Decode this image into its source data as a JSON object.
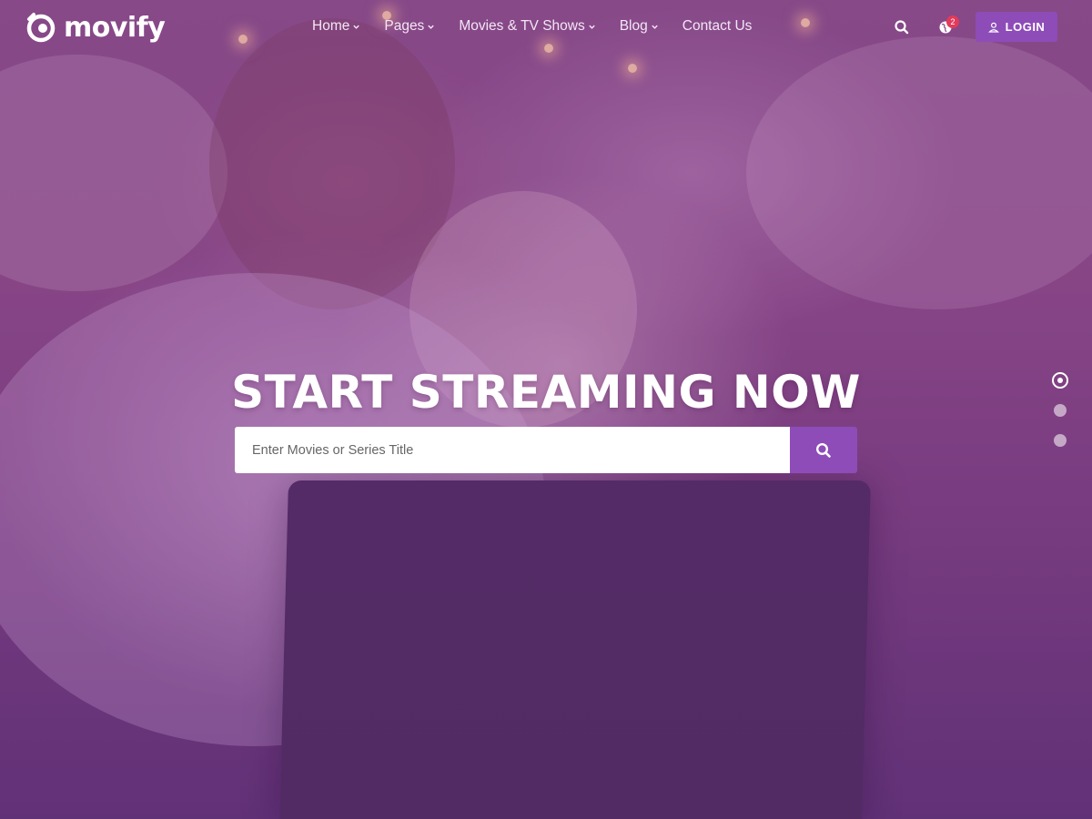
{
  "brand": {
    "name": "movify"
  },
  "nav": {
    "items": [
      {
        "label": "Home",
        "dropdown": true
      },
      {
        "label": "Pages",
        "dropdown": true
      },
      {
        "label": "Movies & TV Shows",
        "dropdown": true
      },
      {
        "label": "Blog",
        "dropdown": true
      },
      {
        "label": "Contact Us",
        "dropdown": false
      }
    ]
  },
  "header": {
    "notification_count": "2",
    "login_label": "LOGIN",
    "icons": [
      "search-icon",
      "globe-icon",
      "user-icon"
    ]
  },
  "hero": {
    "title": "START STREAMING NOW",
    "search_placeholder": "Enter Movies or Series Title",
    "slider": {
      "total": 3,
      "active_index": 0
    }
  },
  "colors": {
    "accent": "#8e4cb8",
    "badge": "#e23a5a",
    "overlay": "#7a3f7e"
  }
}
